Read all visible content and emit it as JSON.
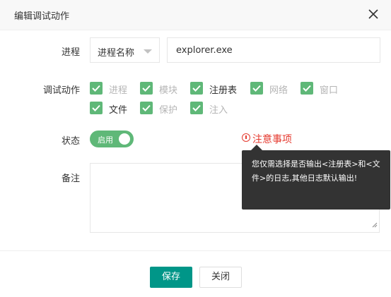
{
  "dialog": {
    "title": "编辑调试动作",
    "close_icon": "close-icon"
  },
  "form": {
    "process_label": "进程",
    "process_select_value": "进程名称",
    "process_input_value": "explorer.exe",
    "action_label": "调试动作",
    "actions": [
      {
        "label": "进程",
        "checked": true,
        "enabled": false
      },
      {
        "label": "模块",
        "checked": true,
        "enabled": false
      },
      {
        "label": "注册表",
        "checked": true,
        "enabled": true
      },
      {
        "label": "网络",
        "checked": true,
        "enabled": false
      },
      {
        "label": "窗口",
        "checked": true,
        "enabled": false
      },
      {
        "label": "文件",
        "checked": true,
        "enabled": true
      },
      {
        "label": "保护",
        "checked": true,
        "enabled": false
      },
      {
        "label": "注入",
        "checked": true,
        "enabled": false
      }
    ],
    "status_label": "状态",
    "status_switch_text": "启用",
    "notice_text": "注意事项",
    "tooltip_text": "您仅需选择是否输出<注册表>和<文件>的日志,其他日志默认输出!",
    "remark_label": "备注",
    "remark_value": ""
  },
  "buttons": {
    "save_label": "保存",
    "close_label": "关闭"
  },
  "colors": {
    "accent": "#009688",
    "checkbox": "#5fb878",
    "notice": "#e53a2f",
    "tooltip_bg": "#333333"
  }
}
